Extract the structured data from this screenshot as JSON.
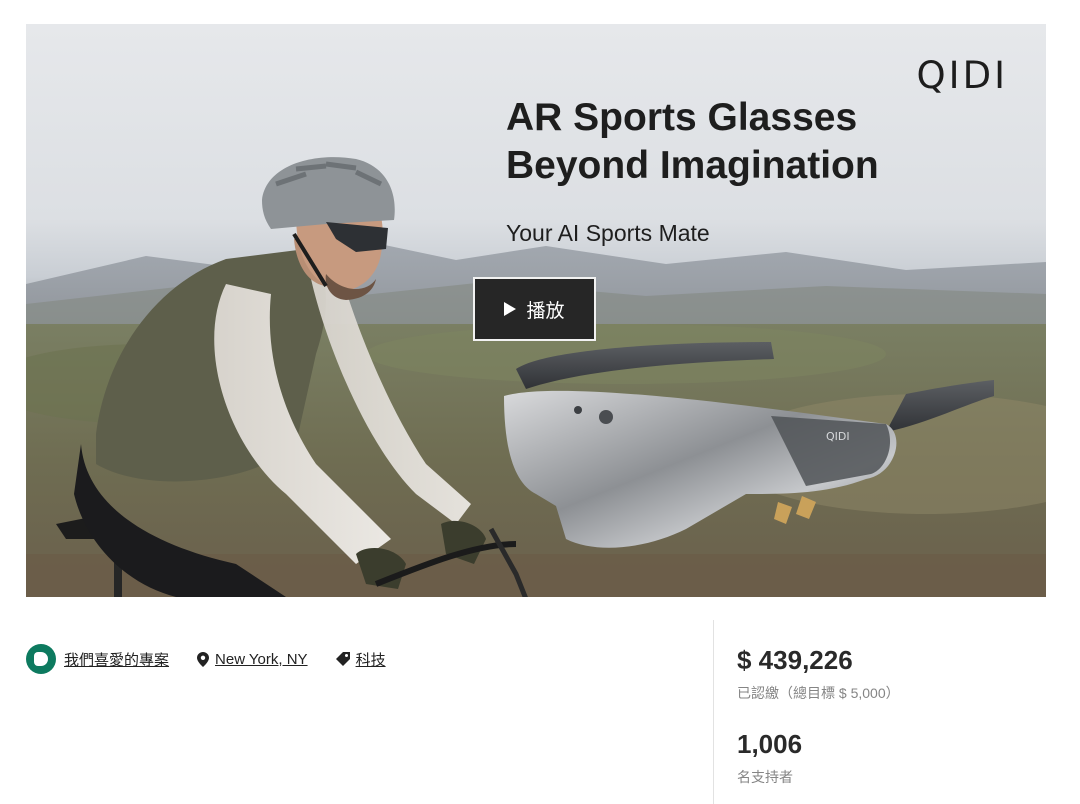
{
  "hero": {
    "brand": "QIDI",
    "headline_line1": "AR Sports Glasses",
    "headline_line2": "Beyond Imagination",
    "tagline": "Your AI Sports Mate",
    "play_label": "播放",
    "glasses_logo": "QIDI"
  },
  "meta": {
    "favorite_label": "我們喜愛的專案",
    "location_label": "New York, NY",
    "category_label": "科技"
  },
  "stats": {
    "amount": "$ 439,226",
    "amount_sub": "已認繳（總目標 $ 5,000）",
    "backers": "1,006",
    "backers_sub": "名支持者"
  },
  "colors": {
    "badge": "#0d7a5f",
    "play_button": "#262626",
    "muted_text": "#858585"
  },
  "icons": [
    "play-icon",
    "projects-we-love-icon",
    "map-pin-icon",
    "tag-icon"
  ]
}
